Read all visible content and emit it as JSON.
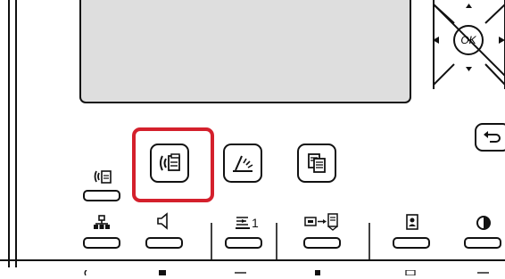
{
  "dpad": {
    "ok_label": "OK"
  },
  "copy_tray": {
    "tray_number": "1"
  },
  "highlight": {
    "color": "#d4202c"
  },
  "colors": {
    "lcd": "#dedede",
    "outline": "#111111"
  }
}
